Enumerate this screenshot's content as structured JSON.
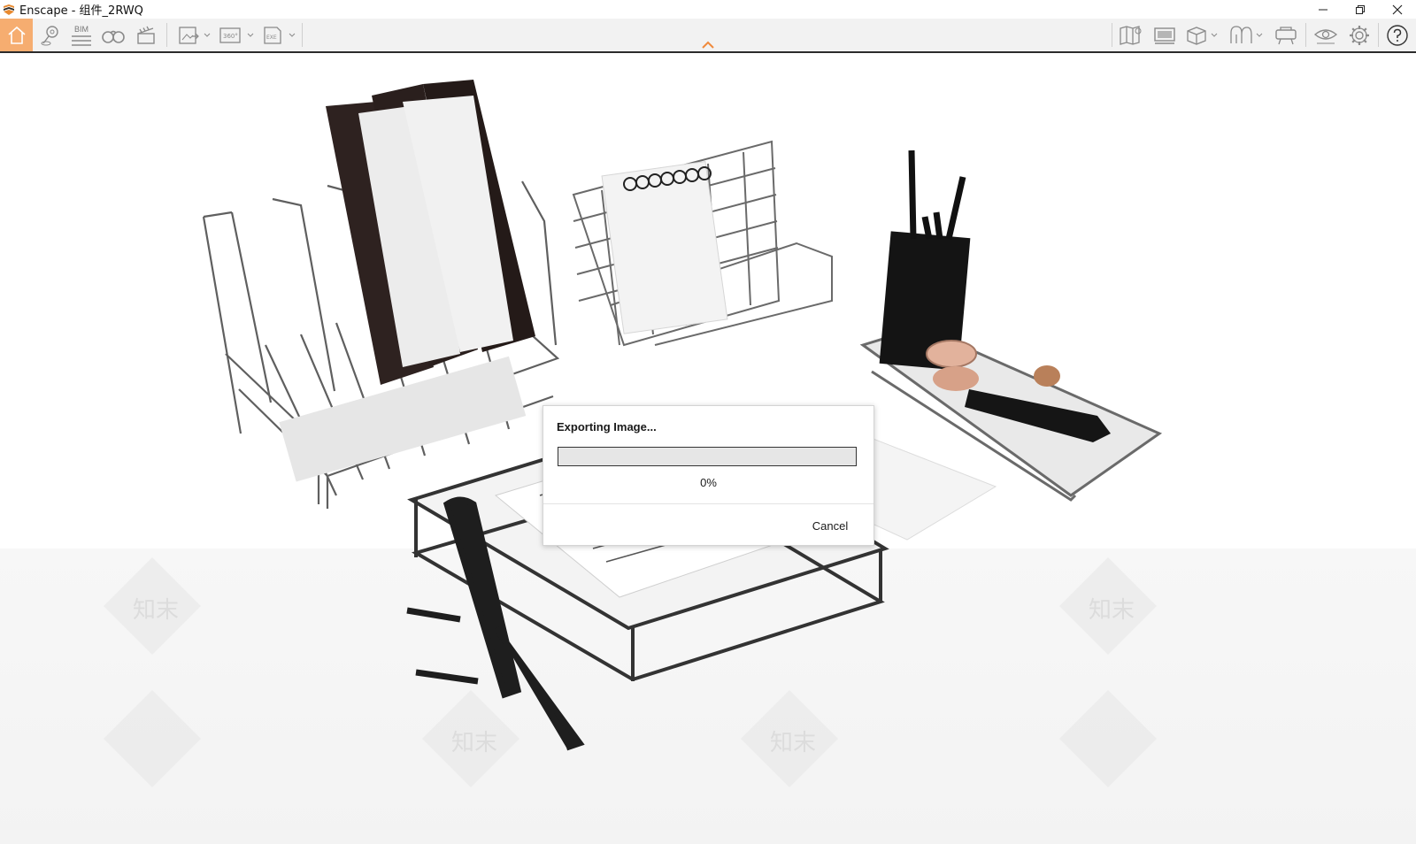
{
  "window": {
    "title": "Enscape - 组件_2RWQ"
  },
  "toolbar": {
    "bim_label": "BIM",
    "accent_color": "#f6ad70",
    "left_icons": [
      "home-icon",
      "location-pin-icon",
      "bim-icon",
      "binoculars-icon",
      "clapperboard-icon",
      "export-image-icon",
      "panorama-360-icon",
      "export-exe-icon"
    ],
    "right_icons": [
      "map-icon",
      "monitor-icon",
      "cube-icon",
      "ghost-icon",
      "projector-icon",
      "eye-icon",
      "gear-icon",
      "help-icon"
    ],
    "panorama_label": "360°",
    "exe_label": "EXE"
  },
  "dialog": {
    "title": "Exporting Image...",
    "progress_fraction": 0,
    "progress_text": "0%",
    "cancel_label": "Cancel"
  },
  "watermark": {
    "text": "知末"
  }
}
